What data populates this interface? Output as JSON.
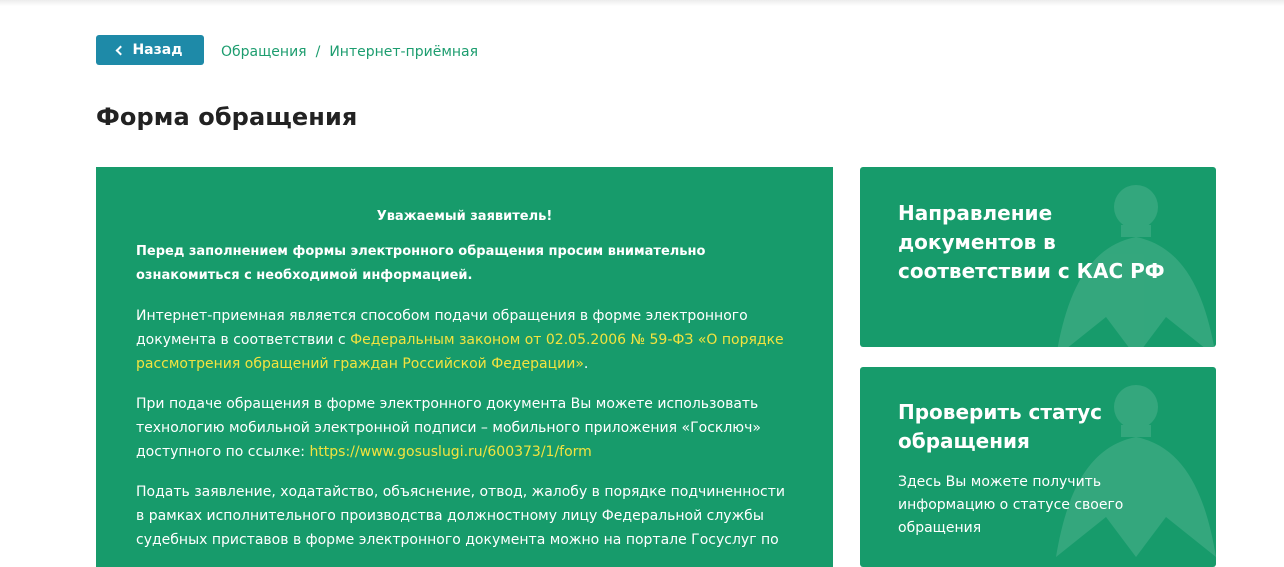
{
  "header": {
    "back_label": "Назад",
    "breadcrumb": [
      "Обращения",
      "Интернет-приёмная"
    ],
    "breadcrumb_separator": "/"
  },
  "page": {
    "title": "Форма обращения"
  },
  "notice": {
    "greeting": "Уважаемый заявитель!",
    "intro": "Перед заполнением формы электронного обращения просим внимательно ознакомиться с необходимой информацией.",
    "p1_text": "Интернет-приемная является способом подачи обращения в форме электронного документа в соответствии с ",
    "p1_link": "Федеральным законом от 02.05.2006 № 59-ФЗ «О порядке рассмотрения обращений граждан Российской Федерации»",
    "p1_end": ".",
    "p2_text": "При подаче обращения в форме электронного документа Вы можете использовать технологию мобильной электронной подписи – мобильного приложения «Госключ» доступного по ссылке: ",
    "p2_link": "https://www.gosuslugi.ru/600373/1/form",
    "p3_text": "Подать заявление, ходатайство, объяснение, отвод, жалобу в порядке подчиненности в рамках исполнительного производства должностному лицу Федеральной службы судебных приставов в форме электронного документа можно на портале Госуслуг по"
  },
  "cards": {
    "kas_title": "Направление документов в соответствии с КАС РФ",
    "status_title": "Проверить статус обращения",
    "status_desc": "Здесь Вы можете получить информацию о статусе своего обращения"
  },
  "colors": {
    "green": "#179b6b",
    "link_yellow": "#f3e33f",
    "back_button": "#1e8aa8",
    "breadcrumb": "#1d9d6f"
  }
}
